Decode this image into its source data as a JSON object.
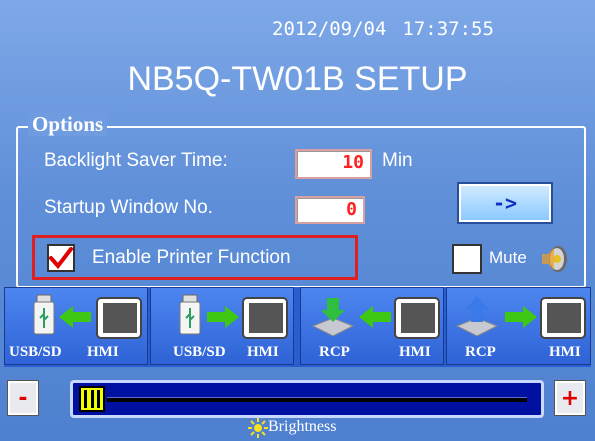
{
  "header": {
    "date": "2012/09/04",
    "time": "17:37:55",
    "title": "NB5Q-TW01B SETUP"
  },
  "options": {
    "group_label": "Options",
    "backlight_label": "Backlight Saver Time:",
    "backlight_value": "10",
    "backlight_unit": "Min",
    "startup_label": "Startup Window No.",
    "startup_value": "0",
    "next_button_label": "->",
    "printer_label": "Enable Printer Function",
    "printer_checked": true,
    "mute_label": "Mute",
    "mute_checked": false
  },
  "transfer_buttons": [
    {
      "from": "USB/SD",
      "to": "HMI",
      "direction": "left",
      "from_icon": "usb-icon"
    },
    {
      "from": "USB/SD",
      "to": "HMI",
      "direction": "right",
      "from_icon": "usb-icon"
    },
    {
      "from": "RCP",
      "to": "HMI",
      "direction": "left",
      "from_icon": "rcp-download-icon"
    },
    {
      "from": "RCP",
      "to": "HMI",
      "direction": "right",
      "from_icon": "rcp-upload-icon"
    }
  ],
  "brightness": {
    "minus_label": "-",
    "plus_label": "+",
    "label": "Brightness",
    "level_fraction": 0.0
  },
  "colors": {
    "accent_red": "#e02020",
    "value_red": "#ff2020",
    "arrow_green": "#3ec814",
    "strip_blue": "#2a5ed0"
  }
}
